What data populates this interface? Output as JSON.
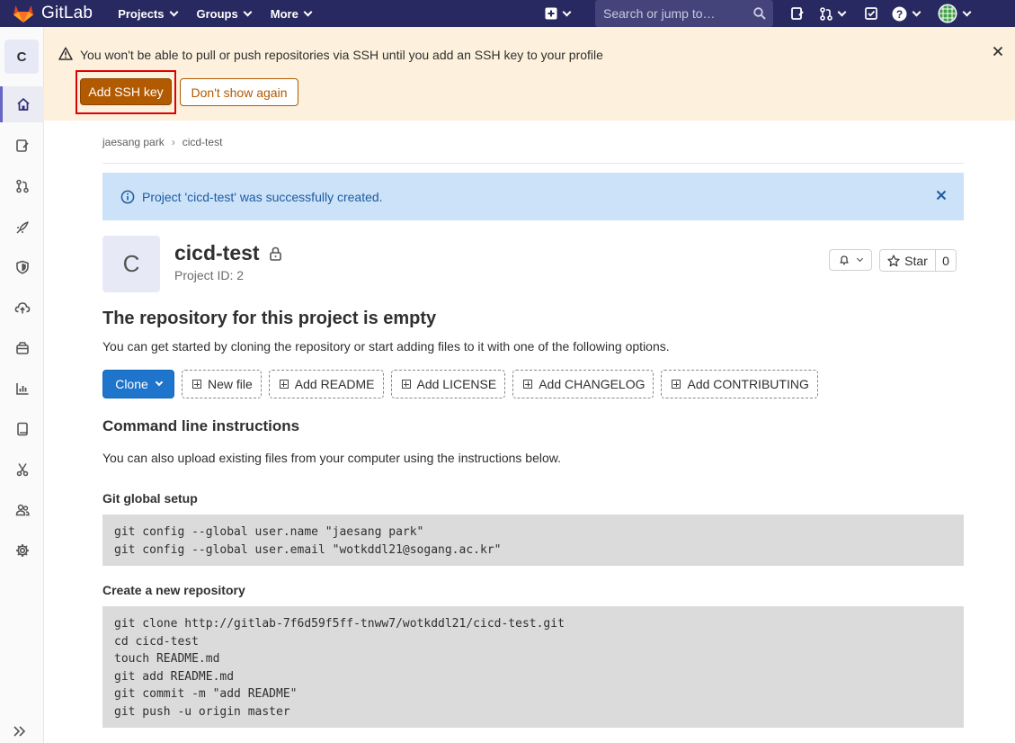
{
  "navbar": {
    "brand": "GitLab",
    "menu": [
      {
        "label": "Projects"
      },
      {
        "label": "Groups"
      },
      {
        "label": "More"
      }
    ],
    "search_placeholder": "Search or jump to…"
  },
  "sidebar": {
    "project_initial": "C",
    "items": [
      {
        "name": "project-overview",
        "icon": "home-icon"
      },
      {
        "name": "issues",
        "icon": "issues-icon"
      },
      {
        "name": "merge-requests",
        "icon": "merge-request-icon"
      },
      {
        "name": "ci-cd",
        "icon": "rocket-icon"
      },
      {
        "name": "security",
        "icon": "shield-icon"
      },
      {
        "name": "deployments",
        "icon": "cloud-icon"
      },
      {
        "name": "packages",
        "icon": "package-icon"
      },
      {
        "name": "analytics",
        "icon": "chart-icon"
      },
      {
        "name": "wiki",
        "icon": "book-icon"
      },
      {
        "name": "snippets",
        "icon": "scissors-icon"
      },
      {
        "name": "members",
        "icon": "users-icon"
      },
      {
        "name": "settings",
        "icon": "gear-icon"
      }
    ]
  },
  "ssh_banner": {
    "message": "You won't be able to pull or push repositories via SSH until you add an SSH key to your profile",
    "add_button": "Add SSH key",
    "dismiss_button": "Don't show again"
  },
  "breadcrumb": [
    "jaesang park",
    "cicd-test"
  ],
  "flash": {
    "message": "Project 'cicd-test' was successfully created."
  },
  "project": {
    "initial": "C",
    "name": "cicd-test",
    "id_label": "Project ID: 2",
    "star_label": "Star",
    "star_count": "0"
  },
  "empty_repo": {
    "heading": "The repository for this project is empty",
    "description": "You can get started by cloning the repository or start adding files to it with one of the following options."
  },
  "actions": {
    "clone": "Clone",
    "buttons": [
      "New file",
      "Add README",
      "Add LICENSE",
      "Add CHANGELOG",
      "Add CONTRIBUTING"
    ]
  },
  "cli": {
    "heading": "Command line instructions",
    "description": "You can also upload existing files from your computer using the instructions below.",
    "global_setup_title": "Git global setup",
    "global_setup_code": "git config --global user.name \"jaesang park\"\ngit config --global user.email \"wotkddl21@sogang.ac.kr\"",
    "new_repo_title": "Create a new repository",
    "new_repo_code": "git clone http://gitlab-7f6d59f5ff-tnww7/wotkddl21/cicd-test.git\ncd cicd-test\ntouch README.md\ngit add README.md\ngit commit -m \"add README\"\ngit push -u origin master"
  },
  "colors": {
    "navbar": "#292961",
    "ssh_banner": "#fdf1dd",
    "ssh_button": "#b25a00",
    "flash": "#cbe2f9",
    "clone_button": "#1f75cb",
    "code_bg": "#dbdbdb"
  }
}
